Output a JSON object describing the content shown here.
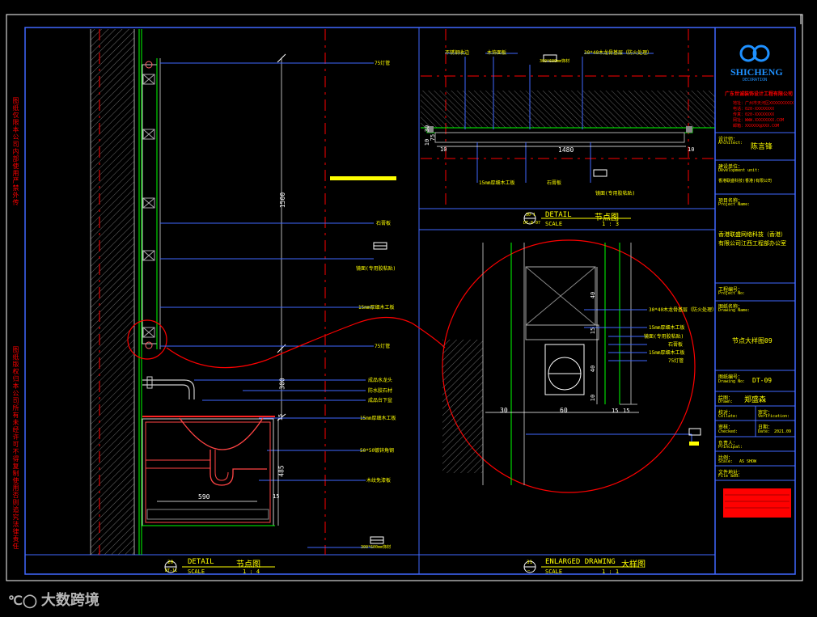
{
  "colors": {
    "background": "#000000",
    "frame": "#4169ff",
    "outer_frame": "#ffffff",
    "text_yellow": "#ffff00",
    "text_white": "#ffffff",
    "red": "#ff0000",
    "green": "#00ff00",
    "cyan": "#00ffff",
    "brand_blue": "#1e90ff"
  },
  "left_margin_notes": {
    "note_top": "图纸仅限本公司内部使用严禁外传",
    "note_bottom": "图纸版权归本公司所有未经许可不得复制使用否则追究法律责任"
  },
  "detail_left": {
    "labels": [
      "75灯管",
      "石膏板",
      "镜面(专用胶粘贴)",
      "15mm厚细木工板",
      "75灯管",
      "成品水龙头",
      "防水胶石材",
      "成品台下盆",
      "15mm厚细木工板",
      "50*50镀锌角钢",
      "木纹免漆板"
    ],
    "tag_1": "300*600mm饰材",
    "tag_2": "300*600mm饰材",
    "dim_1500": "1500",
    "dim_300": "300",
    "dim_485": "485",
    "dim_15": "15",
    "dim_590": "590",
    "dim_15b": "15",
    "title_number": "20",
    "title_sheet": "DT-11",
    "title_en": "DETAIL",
    "title_cn": "节点图",
    "scale_label": "SCALE",
    "scale_value": "1 : 4"
  },
  "detail_top": {
    "labels_top": [
      "不锈钢收边",
      "木饰面板",
      "300*600mm饰材",
      "30*40木龙骨基层（防火处理）"
    ],
    "labels_bottom": [
      "15mm厚细木工板",
      "石膏板",
      "镜面(专用胶粘贴)"
    ],
    "dim_1480": "1480",
    "dim_10a": "10",
    "dim_10b": "10",
    "dim_75": "75",
    "dim_30": "30",
    "dim_10c": "10",
    "title_number": "30-1",
    "title_sheet": "DT-8-07",
    "title_en": "DETAIL",
    "title_cn": "节点图",
    "scale_label": "SCALE",
    "scale_value": "1 : 3"
  },
  "enlarged": {
    "labels": [
      "30*40木龙骨基层（防火处理）",
      "15mm厚细木工板",
      "镜面(专用胶粘贴)",
      "石膏板",
      "15mm厚细木工板",
      "75灯管"
    ],
    "dims_v": [
      "40",
      "15",
      "40",
      "10"
    ],
    "dim_30": "30",
    "dim_60": "60",
    "dim_15a": "15",
    "dim_15b": "15",
    "title_number": "31",
    "title_sheet": "—",
    "title_en": "ENLARGED DRAWING",
    "title_cn": "大样图",
    "scale_label": "SCALE",
    "scale_value": "1 : 1"
  },
  "title_block": {
    "logo_text": "SHICHENG",
    "logo_sub": "DECORATION",
    "company_red": "广东世诚装饰设计工程有限公司",
    "address_lines": [
      "地址：广州市天河区XXXXXXXXXX",
      "电话：020-XXXXXXXX",
      "传真：020-XXXXXXXX",
      "网址：WWW.XXXXXXXX.COM",
      "邮箱：XXXXXX@XXX.COM"
    ],
    "designer_label": "设计师：",
    "designer_label_en": "Architect:",
    "designer_value": "陈言锋",
    "dev_unit_label": "建设单位：",
    "dev_unit_label_en": "Development unit:",
    "dev_unit_value": "香港联盛科技(香港)有限公司",
    "project_label": "项目名称：",
    "project_label_en": "Project Name:",
    "project_value_1": "香港联盛网络科技（香港）",
    "project_value_2": "有限公司江西工程部办公室",
    "project_no_label": "工程编号：",
    "project_no_en": "Project No:",
    "drawing_name_label": "图纸名称：",
    "drawing_name_en": "Drawing Name:",
    "drawing_name_value": "节点大样图09",
    "drawing_no_label": "图纸编号：",
    "drawing_no_en": "Drawing No:",
    "drawing_no_value": "DT-09",
    "drawn_label": "绘图：",
    "drawn_en": "Drawn:",
    "drawn_value": "郑盛森",
    "collate_label": "校对：",
    "collate_en": "Collate:",
    "verify_label": "审定：",
    "verify_en": "Verification:",
    "checked_label": "审核：",
    "checked_en": "Checked:",
    "date_label": "日期：",
    "date_en": "Date:",
    "date_value": "2021.09",
    "principal_label": "负责人：",
    "principal_en": "Principal:",
    "scale_label": "比例：",
    "scale_en": "Scale:",
    "scale_value": "AS SHOW",
    "file_label": "文件地址：",
    "file_en": "File add:"
  },
  "watermark": "大数跨境"
}
